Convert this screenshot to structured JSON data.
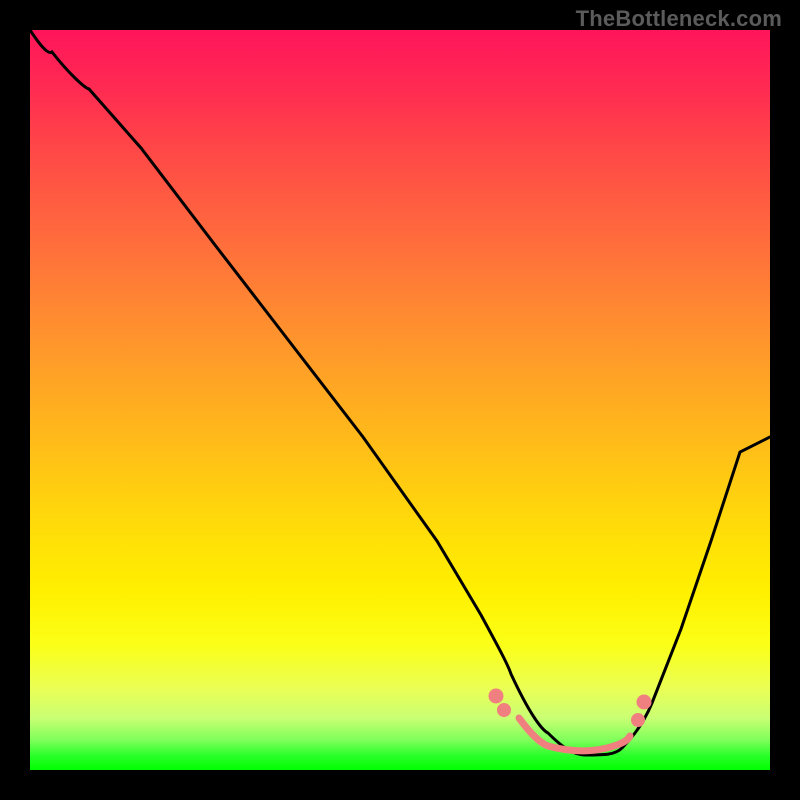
{
  "watermark": "TheBottleneck.com",
  "chart_data": {
    "type": "line",
    "title": "",
    "xlabel": "",
    "ylabel": "",
    "xlim": [
      0,
      100
    ],
    "ylim": [
      0,
      100
    ],
    "grid": false,
    "legend": false,
    "series": [
      {
        "name": "bottleneck-curve",
        "x": [
          0,
          3,
          8,
          15,
          25,
          35,
          45,
          55,
          61,
          65,
          70,
          75,
          80,
          84,
          88,
          92,
          96,
          100
        ],
        "values": [
          100,
          97,
          92,
          84,
          71,
          58,
          45,
          31,
          21,
          13,
          5,
          2,
          2,
          3,
          9,
          19,
          31,
          45
        ],
        "color": "#000000"
      },
      {
        "name": "optimal-marker",
        "x": [
          63,
          66,
          69,
          72,
          75,
          78,
          81,
          83
        ],
        "values": [
          10,
          7,
          5,
          3,
          3,
          3,
          4,
          10
        ],
        "color": "#f08080"
      }
    ],
    "gradient_stops": [
      {
        "pct": 0,
        "color": "#ff155a"
      },
      {
        "pct": 8,
        "color": "#ff2b52"
      },
      {
        "pct": 16,
        "color": "#ff4747"
      },
      {
        "pct": 25,
        "color": "#ff6240"
      },
      {
        "pct": 34,
        "color": "#ff7d36"
      },
      {
        "pct": 43,
        "color": "#ff982b"
      },
      {
        "pct": 52,
        "color": "#ffb11e"
      },
      {
        "pct": 60,
        "color": "#ffc813"
      },
      {
        "pct": 68,
        "color": "#ffde08"
      },
      {
        "pct": 76,
        "color": "#fff000"
      },
      {
        "pct": 83,
        "color": "#fbff17"
      },
      {
        "pct": 89,
        "color": "#eaff55"
      },
      {
        "pct": 93,
        "color": "#c9ff74"
      },
      {
        "pct": 96,
        "color": "#7dff5a"
      },
      {
        "pct": 98,
        "color": "#2bff2b"
      },
      {
        "pct": 100,
        "color": "#00ff00"
      }
    ]
  }
}
